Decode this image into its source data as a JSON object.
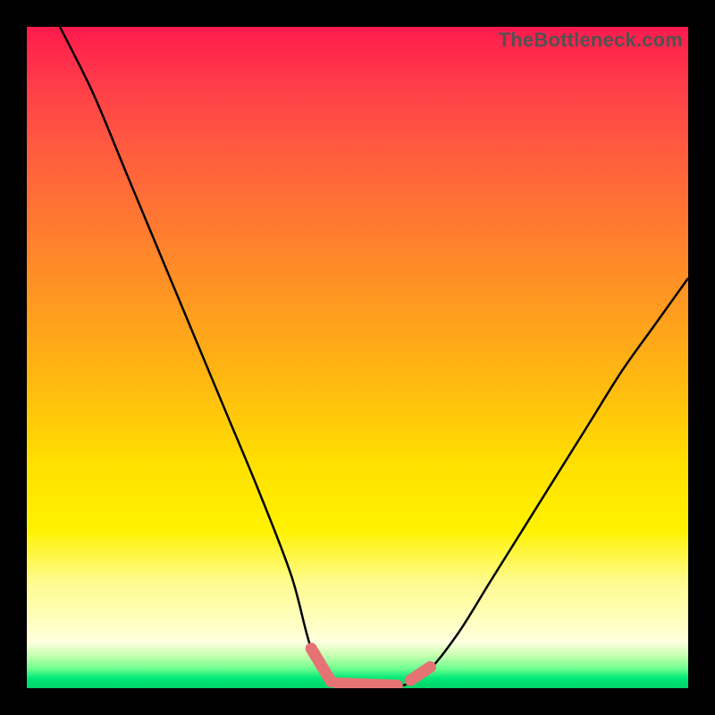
{
  "watermark": "TheBottleneck.com",
  "chart_data": {
    "type": "line",
    "title": "",
    "xlabel": "",
    "ylabel": "",
    "xlim": [
      0,
      100
    ],
    "ylim": [
      0,
      100
    ],
    "series": [
      {
        "name": "bottleneck-curve",
        "x": [
          5,
          10,
          15,
          20,
          25,
          30,
          35,
          40,
          43,
          46,
          50,
          55,
          60,
          65,
          70,
          75,
          80,
          85,
          90,
          95,
          100
        ],
        "values": [
          100,
          90,
          78,
          66,
          54,
          42,
          30,
          17,
          6,
          1,
          0,
          0,
          2,
          8,
          16,
          24,
          32,
          40,
          48,
          55,
          62
        ]
      }
    ],
    "annotations": [
      {
        "name": "optimal-range-marker",
        "x_start": 43,
        "x_end": 60,
        "style": "pink-dashed"
      }
    ],
    "background_gradient": {
      "top": "#ff1a4d",
      "mid": "#ffe000",
      "bottom": "#00d26a"
    }
  }
}
